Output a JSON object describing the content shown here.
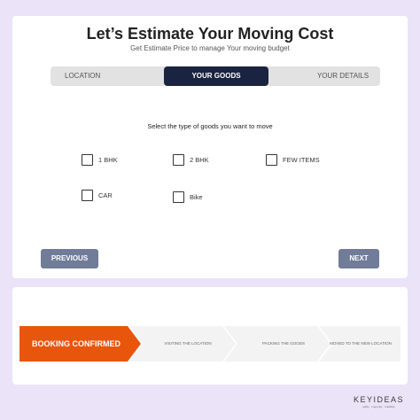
{
  "header": {
    "title": "Let’s Estimate Your Moving Cost",
    "subtitle": "Get Estimate Price to manage Your moving budget"
  },
  "tabs": [
    {
      "label": "LOCATION",
      "active": false
    },
    {
      "label": "YOUR GOODS",
      "active": true
    },
    {
      "label": "YOUR DETAILS",
      "active": false
    }
  ],
  "goods": {
    "instruction": "Select the type of goods you want to move",
    "options": [
      {
        "label": "1 BHK",
        "checked": false
      },
      {
        "label": "2 BHK",
        "checked": false
      },
      {
        "label": "FEW ITEMS",
        "checked": false
      },
      {
        "label": "CAR",
        "checked": false
      },
      {
        "label": "Bike",
        "checked": false
      }
    ]
  },
  "nav": {
    "previous_label": "PREVIOUS",
    "next_label": "NEXT"
  },
  "progress": {
    "steps": [
      {
        "label": "BOOKING CONFIRMED",
        "active": true
      },
      {
        "label": "VISITING THE LOCATION",
        "active": false
      },
      {
        "label": "PACKING THE GOODS",
        "active": false
      },
      {
        "label": "MOVED TO THE NEW LOCATION",
        "active": false
      }
    ]
  },
  "brand": {
    "name": "KEYIDEAS",
    "tagline": "agility · ingenuity · reliability"
  },
  "colors": {
    "background": "#ebe3f7",
    "active_tab": "#1a2440",
    "button": "#707c98",
    "active_step": "#e8560c"
  }
}
